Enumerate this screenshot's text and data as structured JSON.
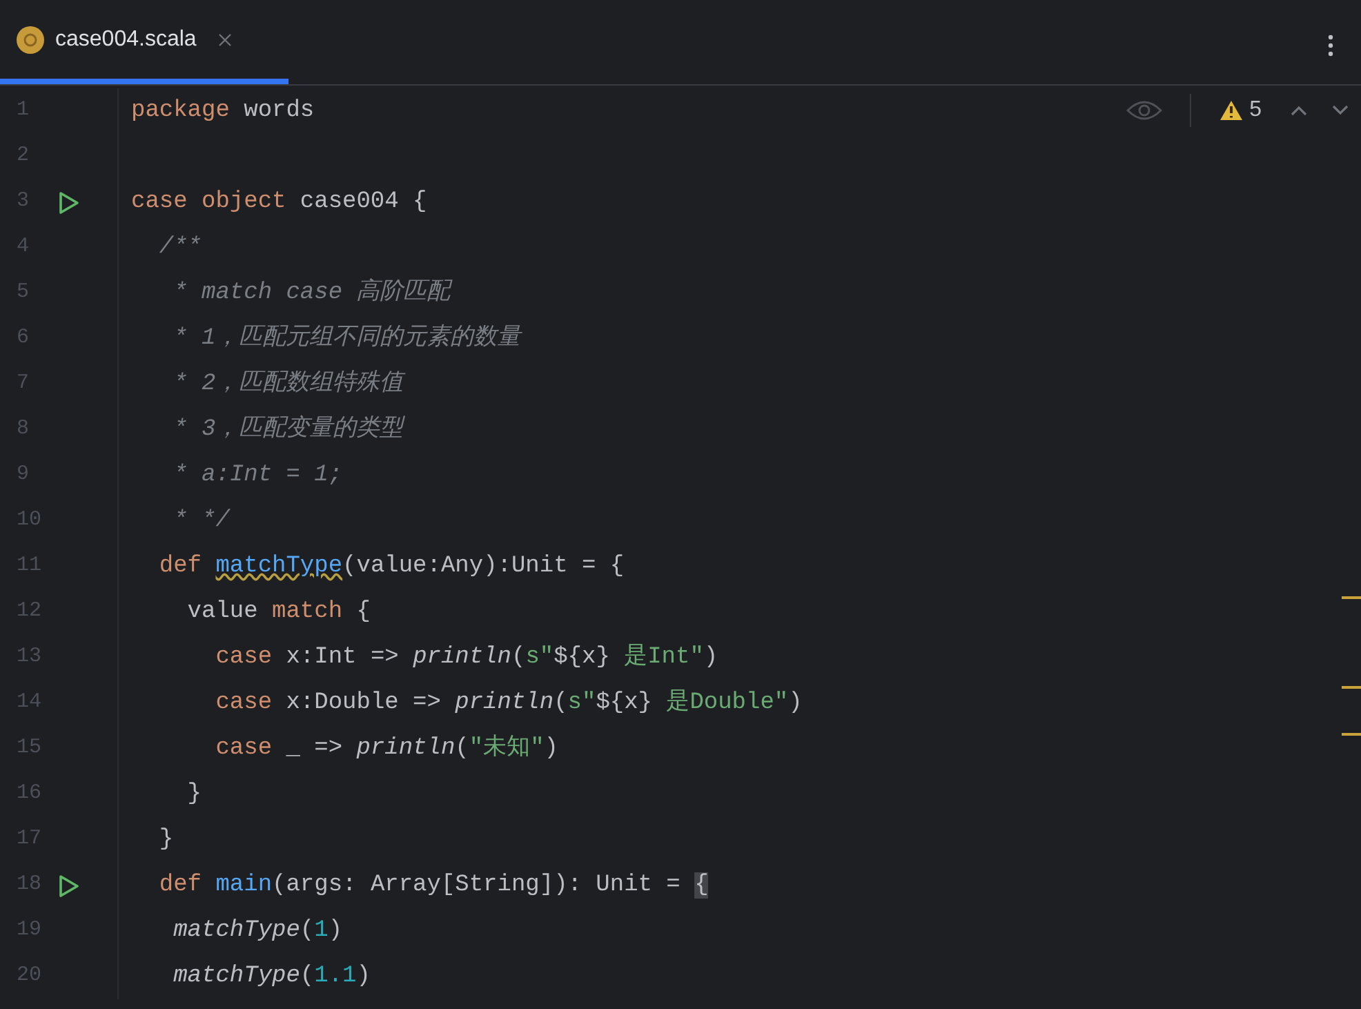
{
  "tabs": [
    {
      "label": "case004.scala",
      "selected": true
    }
  ],
  "inspections": {
    "warning_count": "5"
  },
  "lines": [
    {
      "number": "1",
      "run": false,
      "tokens": [
        {
          "text": "package",
          "kind": "keyword"
        },
        {
          "text": " words",
          "kind": "plain"
        }
      ]
    },
    {
      "number": "2",
      "run": false
    },
    {
      "number": "3",
      "run": true,
      "tokens": [
        {
          "text": "case object",
          "kind": "keyword"
        },
        {
          "text": " case004 {",
          "kind": "plain"
        }
      ]
    },
    {
      "number": "4",
      "run": false,
      "tokens": [
        {
          "text": "  /**",
          "kind": "comment"
        }
      ]
    },
    {
      "number": "5",
      "run": false,
      "tokens": [
        {
          "text": "   * match case 高阶匹配",
          "kind": "comment"
        }
      ]
    },
    {
      "number": "6",
      "run": false,
      "tokens": [
        {
          "text": "   * 1，匹配元组不同的元素的数量",
          "kind": "comment"
        }
      ]
    },
    {
      "number": "7",
      "run": false,
      "tokens": [
        {
          "text": "   * 2，匹配数组特殊值",
          "kind": "comment"
        }
      ]
    },
    {
      "number": "8",
      "run": false,
      "tokens": [
        {
          "text": "   * 3，匹配变量的类型",
          "kind": "comment"
        }
      ]
    },
    {
      "number": "9",
      "run": false,
      "tokens": [
        {
          "text": "   * a:Int = 1;",
          "kind": "comment"
        }
      ]
    },
    {
      "number": "10",
      "run": false,
      "tokens": [
        {
          "text": "   * */",
          "kind": "comment"
        }
      ]
    },
    {
      "number": "11",
      "run": false,
      "tokens": [
        {
          "text": "  def ",
          "kind": "keyword"
        },
        {
          "text": "matchType",
          "kind": "warn-func"
        },
        {
          "text": "(value:Any):Unit = {",
          "kind": "plain"
        }
      ]
    },
    {
      "number": "12",
      "run": false,
      "tokens": [
        {
          "text": "    value ",
          "kind": "plain"
        },
        {
          "text": "match",
          "kind": "keyword"
        },
        {
          "text": " {",
          "kind": "plain"
        }
      ]
    },
    {
      "number": "13",
      "run": false,
      "tokens": [
        {
          "text": "      case",
          "kind": "keyword"
        },
        {
          "text": " x:Int => ",
          "kind": "plain"
        },
        {
          "text": "println",
          "kind": "call"
        },
        {
          "text": "(",
          "kind": "plain"
        },
        {
          "text": "s\"",
          "kind": "string"
        },
        {
          "text": "${x}",
          "kind": "plain"
        },
        {
          "text": " 是Int\"",
          "kind": "string"
        },
        {
          "text": ")",
          "kind": "plain"
        }
      ]
    },
    {
      "number": "14",
      "run": false,
      "tokens": [
        {
          "text": "      case",
          "kind": "keyword"
        },
        {
          "text": " x:Double => ",
          "kind": "plain"
        },
        {
          "text": "println",
          "kind": "call"
        },
        {
          "text": "(",
          "kind": "plain"
        },
        {
          "text": "s\"",
          "kind": "string"
        },
        {
          "text": "${x}",
          "kind": "plain"
        },
        {
          "text": " 是Double\"",
          "kind": "string"
        },
        {
          "text": ")",
          "kind": "plain"
        }
      ]
    },
    {
      "number": "15",
      "run": false,
      "tokens": [
        {
          "text": "      case",
          "kind": "keyword"
        },
        {
          "text": " _ => ",
          "kind": "plain"
        },
        {
          "text": "println",
          "kind": "call"
        },
        {
          "text": "(",
          "kind": "plain"
        },
        {
          "text": "\"未知\"",
          "kind": "string"
        },
        {
          "text": ")",
          "kind": "plain"
        }
      ]
    },
    {
      "number": "16",
      "run": false,
      "tokens": [
        {
          "text": "    }",
          "kind": "plain"
        }
      ]
    },
    {
      "number": "17",
      "run": false,
      "tokens": [
        {
          "text": "  }",
          "kind": "plain"
        }
      ]
    },
    {
      "number": "18",
      "run": true,
      "tokens": [
        {
          "text": "  def ",
          "kind": "keyword"
        },
        {
          "text": "main",
          "kind": "func"
        },
        {
          "text": "(args: Array[String]): Unit = ",
          "kind": "plain"
        },
        {
          "text": "{",
          "kind": "brace-match"
        }
      ]
    },
    {
      "number": "19",
      "run": false,
      "tokens": [
        {
          "text": "   matchType",
          "kind": "call"
        },
        {
          "text": "(",
          "kind": "plain"
        },
        {
          "text": "1",
          "kind": "number"
        },
        {
          "text": ")",
          "kind": "plain"
        }
      ]
    },
    {
      "number": "20",
      "run": false,
      "tokens": [
        {
          "text": "   matchType",
          "kind": "call"
        },
        {
          "text": "(",
          "kind": "plain"
        },
        {
          "text": "1.1",
          "kind": "number"
        },
        {
          "text": ")",
          "kind": "plain"
        }
      ]
    }
  ]
}
